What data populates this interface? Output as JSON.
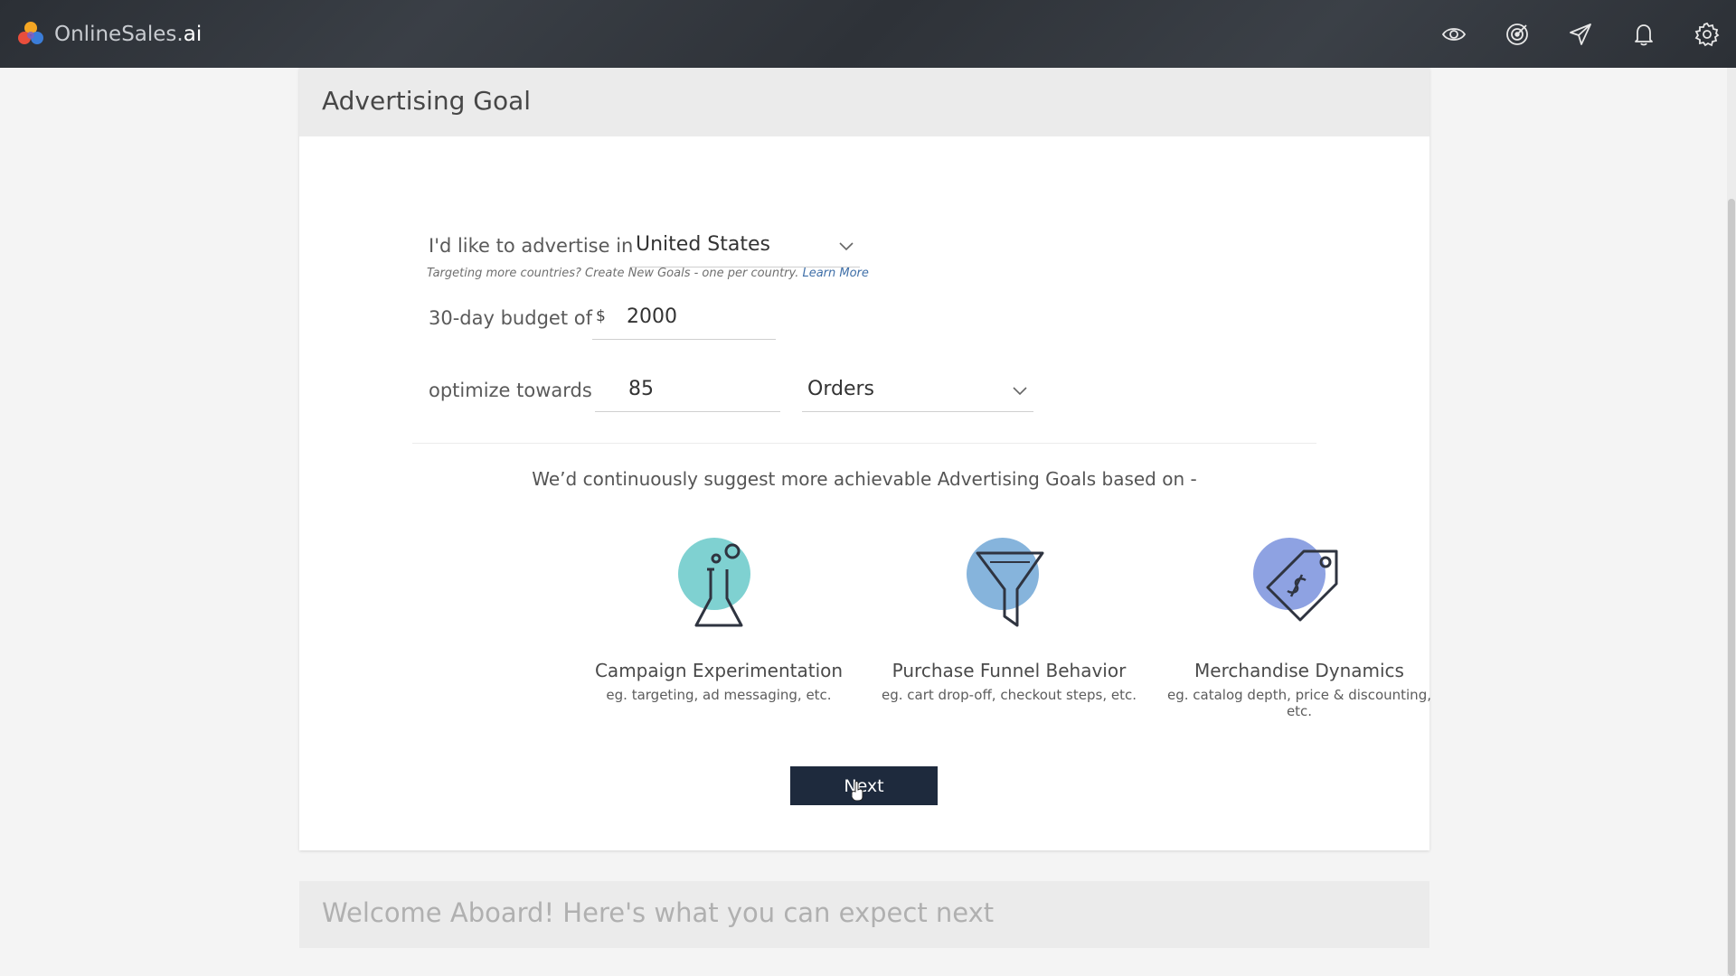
{
  "brand": {
    "name_main": "OnlineSales.",
    "name_suffix": "ai"
  },
  "topbar": {
    "icons": [
      "eye-icon",
      "target-icon",
      "send-icon",
      "bell-icon",
      "gear-icon"
    ]
  },
  "goal_card": {
    "title": "Advertising Goal",
    "country_label": "I'd like to advertise in",
    "country_value": "United States",
    "hint_text": "Targeting more countries? Create New Goals - one per country.",
    "hint_link": "Learn More",
    "budget_label": "30-day budget of",
    "budget_currency": "$",
    "budget_value": "2000",
    "optimize_label": "optimize towards",
    "optimize_value": "85",
    "optimize_metric": "Orders",
    "suggest_text": "We’d continuously suggest more achievable Advertising Goals based on -",
    "features": [
      {
        "title": "Campaign Experimentation",
        "desc": "eg. targeting, ad messaging, etc.",
        "icon": "flask-icon",
        "color": "#7fd1d1"
      },
      {
        "title": "Purchase Funnel Behavior",
        "desc": "eg. cart drop-off, checkout steps, etc.",
        "icon": "funnel-icon",
        "color": "#86b4dc"
      },
      {
        "title": "Merchandise Dynamics",
        "desc": "eg. catalog depth, price & discounting, etc.",
        "icon": "price-tag-icon",
        "color": "#8ea2e2"
      }
    ],
    "next_label": "Next"
  },
  "welcome_card": {
    "title": "Welcome Aboard! Here's what you can expect next"
  }
}
